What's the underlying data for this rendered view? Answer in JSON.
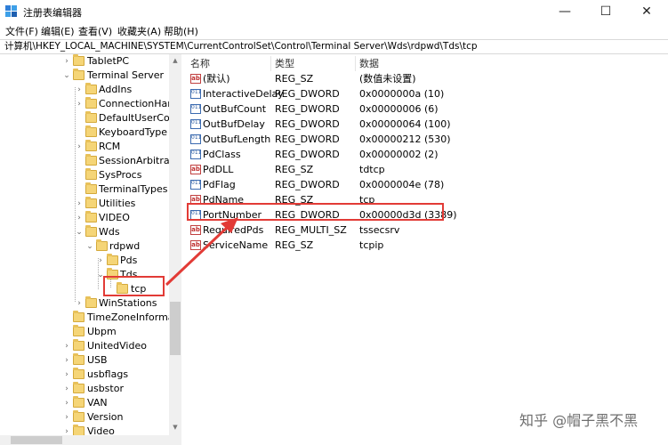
{
  "window": {
    "title": "注册表编辑器",
    "minimize_glyph": "—",
    "maximize_glyph": "☐",
    "close_glyph": "✕"
  },
  "menu": [
    "文件(F)",
    "编辑(E)",
    "查看(V)",
    "收藏夹(A)",
    "帮助(H)"
  ],
  "address": "计算机\\HKEY_LOCAL_MACHINE\\SYSTEM\\CurrentControlSet\\Control\\Terminal Server\\Wds\\rdpwd\\Tds\\tcp",
  "tree": {
    "items": [
      {
        "label": "TabletPC",
        "arrow": "›"
      },
      {
        "label": "Terminal Server",
        "arrow": "⌄"
      },
      {
        "label": "AddIns",
        "arrow": "›"
      },
      {
        "label": "ConnectionHandle",
        "arrow": "›"
      },
      {
        "label": "DefaultUserConfig",
        "arrow": ""
      },
      {
        "label": "KeyboardType M",
        "arrow": ""
      },
      {
        "label": "RCM",
        "arrow": "›"
      },
      {
        "label": "SessionArbitration",
        "arrow": ""
      },
      {
        "label": "SysProcs",
        "arrow": ""
      },
      {
        "label": "TerminalTypes",
        "arrow": ""
      },
      {
        "label": "Utilities",
        "arrow": "›"
      },
      {
        "label": "VIDEO",
        "arrow": "›"
      },
      {
        "label": "Wds",
        "arrow": "⌄"
      },
      {
        "label": "rdpwd",
        "arrow": "⌄"
      },
      {
        "label": "Pds",
        "arrow": "›"
      },
      {
        "label": "Tds",
        "arrow": "⌄"
      },
      {
        "label": "tcp",
        "arrow": ""
      },
      {
        "label": "WinStations",
        "arrow": "›"
      },
      {
        "label": "TimeZoneInformatio",
        "arrow": ""
      },
      {
        "label": "Ubpm",
        "arrow": ""
      },
      {
        "label": "UnitedVideo",
        "arrow": "›"
      },
      {
        "label": "USB",
        "arrow": "›"
      },
      {
        "label": "usbflags",
        "arrow": "›"
      },
      {
        "label": "usbstor",
        "arrow": "›"
      },
      {
        "label": "VAN",
        "arrow": "›"
      },
      {
        "label": "Version",
        "arrow": "›"
      },
      {
        "label": "Video",
        "arrow": "›"
      }
    ]
  },
  "list": {
    "headers": {
      "name": "名称",
      "type": "类型",
      "data": "数据"
    },
    "rows": [
      {
        "icon": "ab",
        "name": "(默认)",
        "type": "REG_SZ",
        "data": "(数值未设置)"
      },
      {
        "icon": "bin",
        "name": "InteractiveDelay",
        "type": "REG_DWORD",
        "data": "0x0000000a (10)"
      },
      {
        "icon": "bin",
        "name": "OutBufCount",
        "type": "REG_DWORD",
        "data": "0x00000006 (6)"
      },
      {
        "icon": "bin",
        "name": "OutBufDelay",
        "type": "REG_DWORD",
        "data": "0x00000064 (100)"
      },
      {
        "icon": "bin",
        "name": "OutBufLength",
        "type": "REG_DWORD",
        "data": "0x00000212 (530)"
      },
      {
        "icon": "bin",
        "name": "PdClass",
        "type": "REG_DWORD",
        "data": "0x00000002 (2)"
      },
      {
        "icon": "ab",
        "name": "PdDLL",
        "type": "REG_SZ",
        "data": "tdtcp"
      },
      {
        "icon": "bin",
        "name": "PdFlag",
        "type": "REG_DWORD",
        "data": "0x0000004e (78)"
      },
      {
        "icon": "ab",
        "name": "PdName",
        "type": "REG_SZ",
        "data": "tcp"
      },
      {
        "icon": "bin",
        "name": "PortNumber",
        "type": "REG_DWORD",
        "data": "0x00000d3d (3389)"
      },
      {
        "icon": "ab",
        "name": "RequiredPds",
        "type": "REG_MULTI_SZ",
        "data": "tssecsrv"
      },
      {
        "icon": "ab",
        "name": "ServiceName",
        "type": "REG_SZ",
        "data": "tcpip"
      }
    ]
  },
  "icons": {
    "ab": "ab",
    "bin": "011 110"
  },
  "annotation": {
    "color": "#e23b36"
  },
  "watermark": "知乎 @帽子黑不黑"
}
